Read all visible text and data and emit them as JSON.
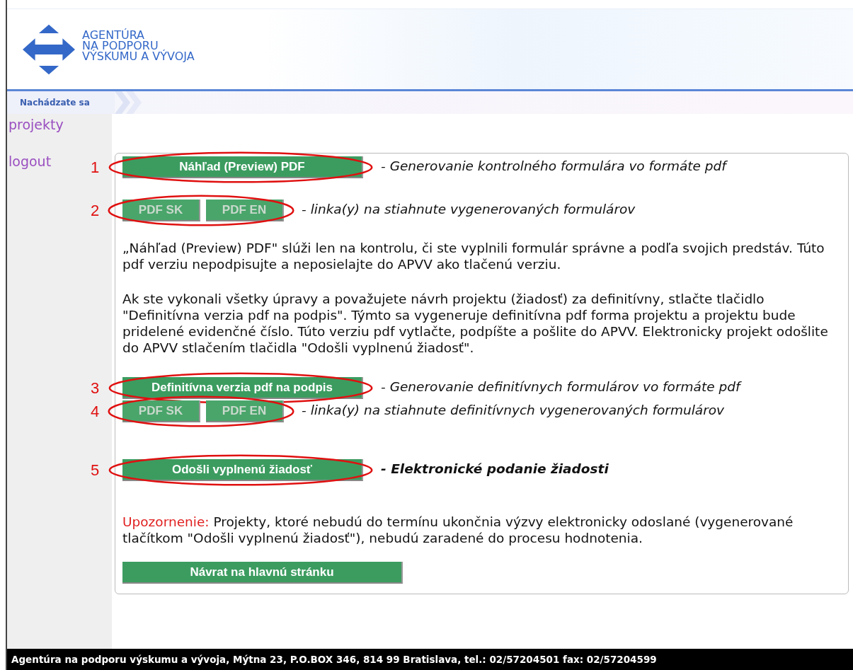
{
  "logo": {
    "lines": [
      "AGENTÚRA",
      "NA PODPORU",
      "VÝSKUMU A VÝVOJA"
    ]
  },
  "breadcrumb": {
    "label": "Nachádzate sa"
  },
  "sidebar": {
    "items": [
      {
        "label": "projekty"
      },
      {
        "label": "logout"
      }
    ]
  },
  "content": [
    {
      "kind": "action",
      "annotation": "1",
      "buttons": [
        {
          "label": "Náhľad (Preview) PDF",
          "disabled": false
        }
      ],
      "note": "- Generovanie kontrolného formulára vo formáte pdf",
      "bold": false
    },
    {
      "kind": "action",
      "annotation": "2",
      "buttons": [
        {
          "label": "PDF SK",
          "disabled": true
        },
        {
          "label": "PDF EN",
          "disabled": true
        }
      ],
      "note": "- linka(y) na stiahnute vygenerovaných formulárov",
      "bold": false
    },
    {
      "kind": "paragraph",
      "text": "„Náhľad (Preview) PDF\" slúži len na kontrolu, či ste vyplnili formulár správne a podľa svojich predstáv. Túto pdf verziu nepodpisujte a neposielajte do APVV ako tlačenú verziu."
    },
    {
      "kind": "paragraph",
      "text": "Ak ste vykonali všetky úpravy a považujete návrh projektu (žiadosť) za definitívny, stlačte tlačidlo \"Definitívna verzia pdf na podpis\". Týmto sa vygeneruje definitívna pdf forma projektu a projektu bude pridelené evidenčné číslo. Túto verziu pdf vytlačte, podpíšte a pošlite do APVV. Elektronicky projekt odošlite do APVV stlačením tlačidla \"Odošli vyplnenú žiadosť\"."
    },
    {
      "kind": "action",
      "annotation": "3",
      "buttons": [
        {
          "label": "Definitívna verzia pdf na podpis",
          "disabled": false
        }
      ],
      "note": "- Generovanie definitívnych formulárov vo formáte pdf",
      "bold": false
    },
    {
      "kind": "action",
      "annotation": "4",
      "buttons": [
        {
          "label": "PDF SK",
          "disabled": true
        },
        {
          "label": "PDF EN",
          "disabled": true
        }
      ],
      "note": "- linka(y) na stiahnute definitívnych vygenerovaných formulárov",
      "bold": false
    },
    {
      "kind": "action",
      "annotation": "5",
      "buttons": [
        {
          "label": "Odošli vyplnenú žiadosť",
          "disabled": false
        }
      ],
      "note": "- Elektronické podanie žiadosti",
      "bold": true
    },
    {
      "kind": "warning",
      "label": "Upozornenie:",
      "text": "Projekty, ktoré nebudú do termínu ukončnia výzvy elektronicky odoslané (vygenerované tlačítkom \"Odošli vyplnenú žiadosť\"), nebudú zaradené do procesu hodnotenia."
    },
    {
      "kind": "back",
      "label": "Návrat na hlavnú stránku"
    }
  ],
  "footer": "Agentúra na podporu výskumu a vývoja, Mýtna 23, P.O.BOX 346, 814 99 Bratislava, tel.: 02/57204501 fax: 02/57204599"
}
